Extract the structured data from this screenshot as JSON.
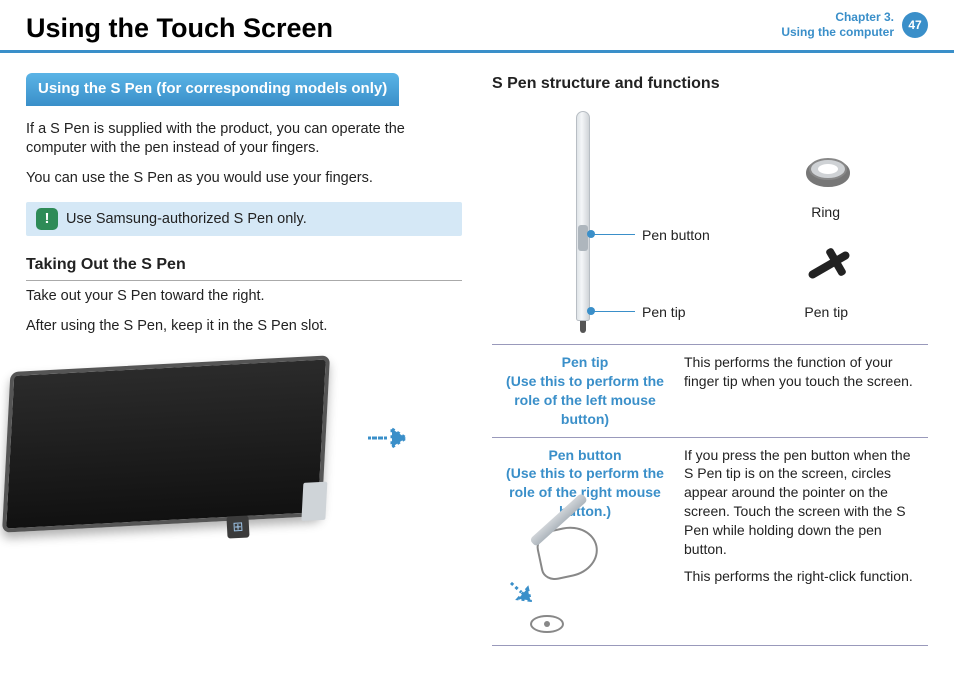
{
  "header": {
    "title": "Using the Touch Screen",
    "chapter_line1": "Chapter 3.",
    "chapter_line2": "Using the computer",
    "page_number": "47"
  },
  "left": {
    "section_tag": "Using the S Pen (for corresponding models only)",
    "p1": "If a S Pen is supplied with the product, you can operate the computer with the pen instead of your fingers.",
    "p2": "You can use the S Pen as you would use your fingers.",
    "note_icon": "!",
    "note_text": "Use Samsung-authorized S Pen only.",
    "sub_heading": "Taking Out the S Pen",
    "p3": "Take out your S Pen toward the right.",
    "p4": "After using the S Pen, keep it in the S Pen slot.",
    "win_glyph": "⊞"
  },
  "right": {
    "heading": "S Pen structure and functions",
    "label_pen_button": "Pen button",
    "label_pen_tip": "Pen tip",
    "label_ring": "Ring",
    "label_nib": "Pen tip",
    "table": {
      "row1_key_line1": "Pen tip",
      "row1_key_line2": "(Use this to perform the role of the left mouse button)",
      "row1_val": "This performs the function of your finger tip when you touch the screen.",
      "row2_key_line1": "Pen button",
      "row2_key_line2": "(Use this to perform the role of the right mouse button.)",
      "row2_val_p1": "If you press the pen button when the S Pen tip is on the screen, circles appear around the pointer on the screen. Touch the screen with the S Pen while holding down the pen button.",
      "row2_val_p2": "This performs the right-click function."
    }
  }
}
